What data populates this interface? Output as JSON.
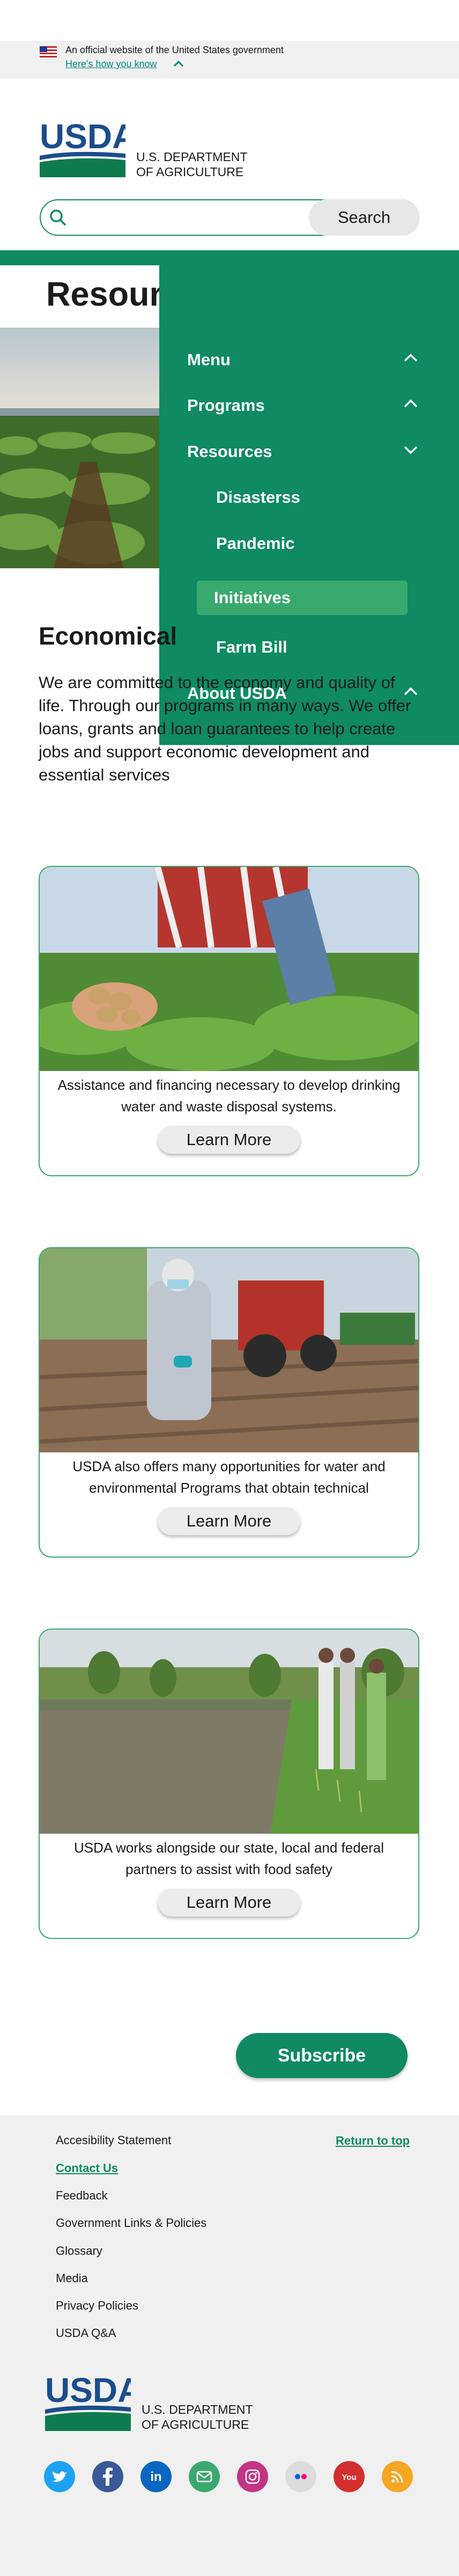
{
  "gov_banner": {
    "official_text": "An official website of the United States government",
    "how_know_link": "Here's how you know"
  },
  "header": {
    "logo_text": "USDA",
    "dept_line1": "U.S. DEPARTMENT",
    "dept_line2": "OF AGRICULTURE"
  },
  "search": {
    "placeholder": "",
    "button_label": "Search"
  },
  "page": {
    "title": "Resources"
  },
  "dropdown": {
    "items": [
      {
        "label": "Menu",
        "expanded": false
      },
      {
        "label": "Programs",
        "expanded": false
      },
      {
        "label": "Resources",
        "expanded": true
      },
      {
        "label": "About USDA",
        "expanded": false
      }
    ],
    "sub_items": [
      {
        "label": "Disasterss",
        "active": false
      },
      {
        "label": "Pandemic",
        "active": false
      },
      {
        "label": "Initiatives",
        "active": true
      },
      {
        "label": "Farm Bill",
        "active": false
      }
    ]
  },
  "economic": {
    "title": "Economical",
    "text": "We are committed to the economy and quality of life. Through our programs in many ways. We offer loans, grants and loan guarantees to help create jobs and support economic development and essential services"
  },
  "cards": [
    {
      "caption": "Assistance and financing necessary to develop drinking water and waste disposal systems.",
      "button": "Learn More"
    },
    {
      "caption": "USDA also offers many opportunities for water and environmental Programs that obtain technical",
      "button": "Learn More"
    },
    {
      "caption": "USDA works alongside our state, local and federal partners to assist with food safety",
      "button": "Learn More"
    }
  ],
  "subscribe_label": "Subscribe",
  "footer": {
    "links": [
      "Accesibility Statement",
      "Contact Us",
      "Feedback",
      "Government Links & Policies",
      "Glossary",
      "Media",
      "Privacy Policies",
      "USDA Q&A"
    ],
    "return_to_top": "Return to top",
    "logo_text": "USDA",
    "dept_line1": "U.S. DEPARTMENT",
    "dept_line2": "OF AGRICULTURE",
    "social": [
      {
        "name": "twitter-icon",
        "color": "#1da1f2"
      },
      {
        "name": "facebook-icon",
        "color": "#3b5998"
      },
      {
        "name": "linkedin-icon",
        "color": "#0a66c2"
      },
      {
        "name": "email-icon",
        "color": "#3aa96d"
      },
      {
        "name": "instagram-icon",
        "color": "#c13584"
      },
      {
        "name": "flickr-icon",
        "color": "#dcdcdc"
      },
      {
        "name": "youtube-icon",
        "color": "#d32f2f"
      },
      {
        "name": "rss-icon",
        "color": "#f5a623"
      }
    ]
  },
  "colors": {
    "brand_green": "#0f8a62",
    "active_green": "#3aa96d",
    "usda_blue": "#1b4d8c"
  }
}
